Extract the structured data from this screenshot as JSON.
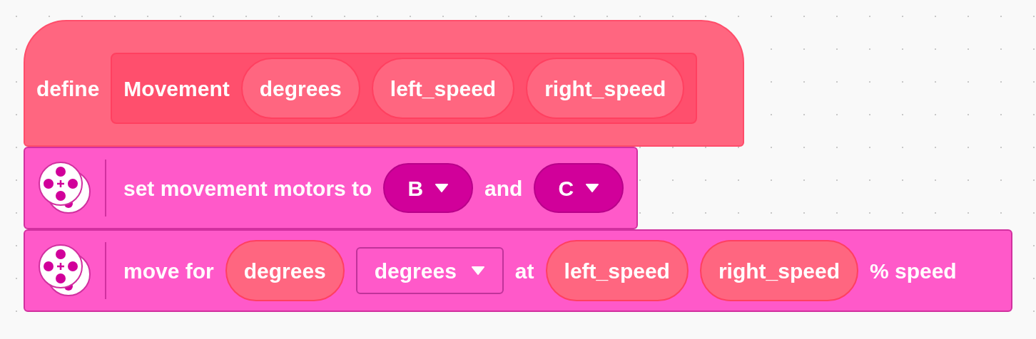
{
  "define_block": {
    "keyword": "define",
    "name": "Movement",
    "params": [
      "degrees",
      "left_speed",
      "right_speed"
    ]
  },
  "blocks": [
    {
      "segments": [
        {
          "kind": "text",
          "text": "set movement motors to"
        },
        {
          "kind": "dropdown",
          "text": "B"
        },
        {
          "kind": "text",
          "text": "and"
        },
        {
          "kind": "dropdown",
          "text": "C"
        }
      ]
    },
    {
      "segments": [
        {
          "kind": "text",
          "text": "move for"
        },
        {
          "kind": "reporter",
          "text": "degrees"
        },
        {
          "kind": "menu",
          "text": "degrees"
        },
        {
          "kind": "text",
          "text": "at"
        },
        {
          "kind": "reporter",
          "text": "left_speed"
        },
        {
          "kind": "reporter",
          "text": "right_speed"
        },
        {
          "kind": "text",
          "text": "% speed"
        }
      ]
    }
  ]
}
